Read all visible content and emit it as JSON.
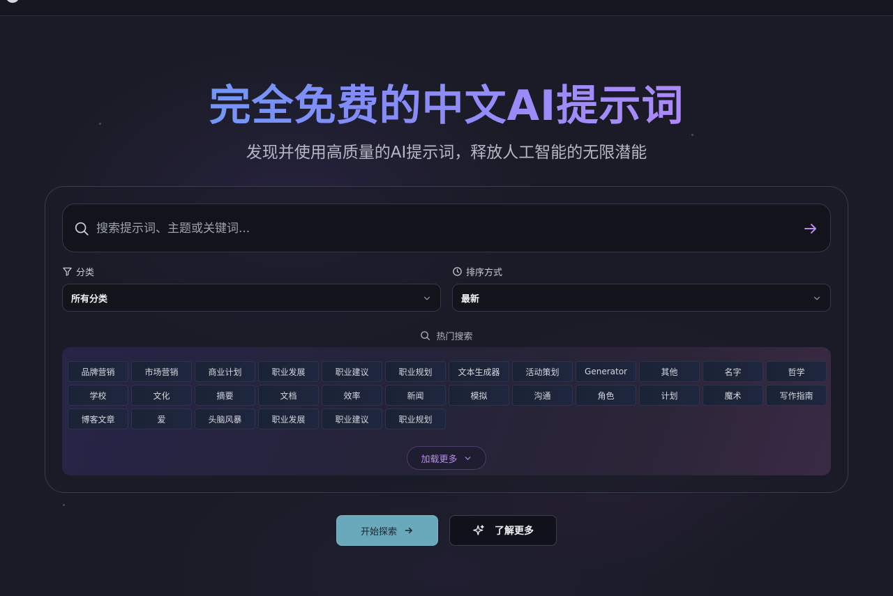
{
  "hero": {
    "title": "完全免费的中文AI提示词",
    "subtitle": "发现并使用高质量的AI提示词，释放人工智能的无限潜能"
  },
  "search": {
    "placeholder": "搜索提示词、主题或关键词...",
    "value": ""
  },
  "filters": {
    "category_label": "分类",
    "category_value": "所有分类",
    "sort_label": "排序方式",
    "sort_value": "最新"
  },
  "hot": {
    "title": "热门搜索",
    "tags": [
      "品牌营销",
      "市场营销",
      "商业计划",
      "职业发展",
      "职业建议",
      "职业规划",
      "文本生成器",
      "活动策划",
      "Generator",
      "其他",
      "名字",
      "哲学",
      "学校",
      "文化",
      "摘要",
      "文档",
      "效率",
      "新闻",
      "模拟",
      "沟通",
      "角色",
      "计划",
      "魔术",
      "写作指南",
      "博客文章",
      "爱",
      "头脑风暴",
      "职业发展",
      "职业建议",
      "职业规划"
    ],
    "load_more": "加载更多"
  },
  "actions": {
    "start_label": "开始探索",
    "learn_label": "了解更多"
  },
  "colors": {
    "accent_purple": "#b98af0",
    "start_button": "#6aa8bb",
    "title_gradient_start": "#60a5fa",
    "title_gradient_end": "#c084fc"
  },
  "icons": {
    "search": "search-icon",
    "submit": "arrow-right-icon",
    "filter": "filter-icon",
    "sort": "clock-icon",
    "chevron": "chevron-down-icon",
    "sparkle": "sparkle-icon"
  }
}
